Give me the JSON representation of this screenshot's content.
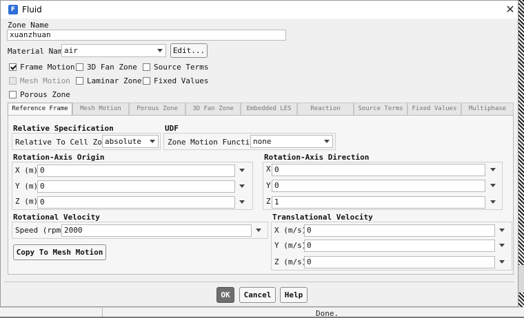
{
  "window": {
    "title": "Fluid",
    "app_icon_letter": "F"
  },
  "zone": {
    "name_label": "Zone Name",
    "name_value": "xuanzhuan"
  },
  "material": {
    "label": "Material Name",
    "value": "air",
    "edit_label": "Edit..."
  },
  "options": {
    "frame_motion": {
      "label": "Frame Motion",
      "checked": true
    },
    "fan_zone_3d": {
      "label": "3D Fan Zone",
      "checked": false
    },
    "source_terms": {
      "label": "Source Terms",
      "checked": false
    },
    "mesh_motion": {
      "label": "Mesh Motion",
      "checked": false,
      "disabled": true
    },
    "laminar_zone": {
      "label": "Laminar Zone",
      "checked": false
    },
    "fixed_values": {
      "label": "Fixed Values",
      "checked": false
    },
    "porous_zone": {
      "label": "Porous Zone",
      "checked": false
    }
  },
  "tabs": [
    {
      "label": "Reference Frame",
      "active": true
    },
    {
      "label": "Mesh Motion"
    },
    {
      "label": "Porous Zone"
    },
    {
      "label": "3D Fan Zone"
    },
    {
      "label": "Embedded LES"
    },
    {
      "label": "Reaction"
    },
    {
      "label": "Source Terms"
    },
    {
      "label": "Fixed Values"
    },
    {
      "label": "Multiphase"
    }
  ],
  "relative_spec": {
    "title": "Relative Specification",
    "label": "Relative To Cell Zone",
    "value": "absolute"
  },
  "udf": {
    "title": "UDF",
    "label": "Zone Motion Function",
    "value": "none"
  },
  "axis_origin": {
    "title": "Rotation-Axis Origin",
    "x": {
      "label": "X (m)",
      "value": "0"
    },
    "y": {
      "label": "Y (m)",
      "value": "0"
    },
    "z": {
      "label": "Z (m)",
      "value": "0"
    }
  },
  "axis_direction": {
    "title": "Rotation-Axis Direction",
    "x": {
      "label": "X",
      "value": "0"
    },
    "y": {
      "label": "Y",
      "value": "0"
    },
    "z": {
      "label": "Z",
      "value": "1"
    }
  },
  "rotational_velocity": {
    "title": "Rotational Velocity",
    "speed_label": "Speed (rpm)",
    "speed_value": "2000",
    "copy_label": "Copy To Mesh Motion"
  },
  "translational_velocity": {
    "title": "Translational Velocity",
    "x": {
      "label": "X (m/s)",
      "value": "0"
    },
    "y": {
      "label": "Y (m/s)",
      "value": "0"
    },
    "z": {
      "label": "Z (m/s)",
      "value": "0"
    }
  },
  "buttons": {
    "ok": "OK",
    "cancel": "Cancel",
    "help": "Help"
  },
  "background": {
    "console_text": "Done."
  }
}
